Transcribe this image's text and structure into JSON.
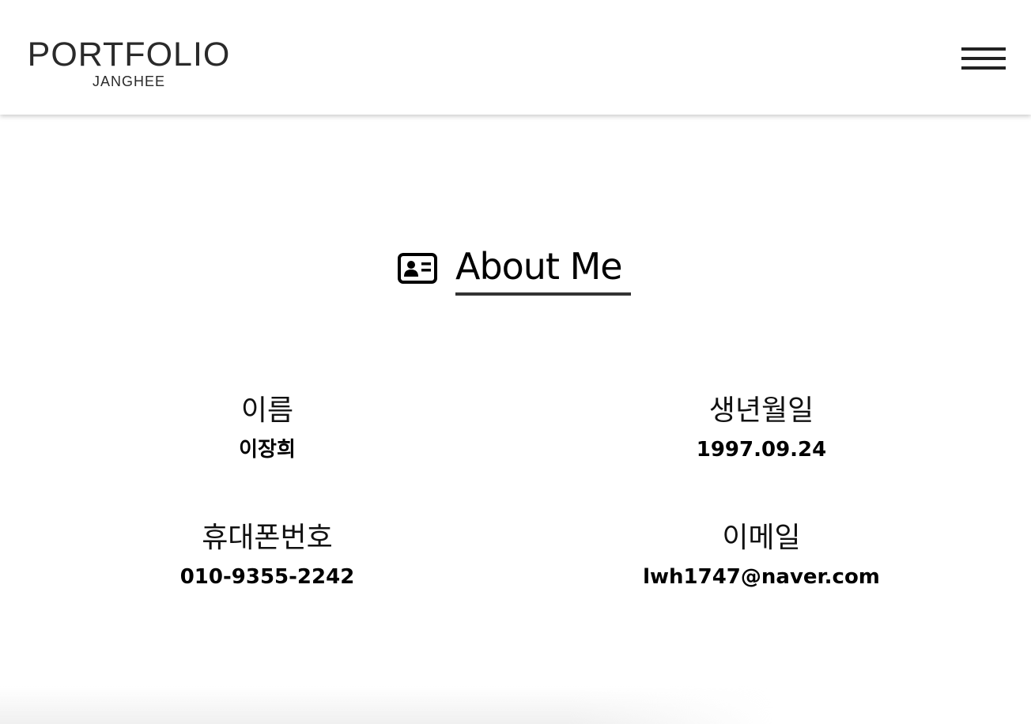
{
  "header": {
    "logo_title": "PORTFOLIO",
    "logo_subtitle": "JANGHEE",
    "menu_icon": "hamburger-menu-icon"
  },
  "about": {
    "icon": "id-card-icon",
    "title": "About Me",
    "items": [
      {
        "label": "이름",
        "value": "이장희"
      },
      {
        "label": "생년월일",
        "value": "1997.09.24"
      },
      {
        "label": "휴대폰번호",
        "value": "010-9355-2242"
      },
      {
        "label": "이메일",
        "value": "lwh1747@naver.com"
      }
    ]
  },
  "colors": {
    "text": "#000000",
    "logo": "#2a2a2a",
    "menu_bar": "#222222",
    "underline": "#333333",
    "background": "#ffffff"
  }
}
